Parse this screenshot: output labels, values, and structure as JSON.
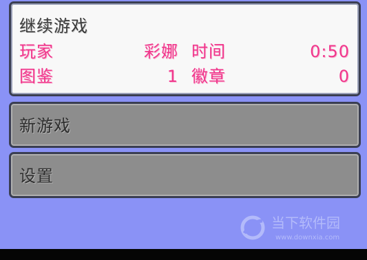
{
  "menu": {
    "continue_title": "继续游戏",
    "player_label": "玩家",
    "player_name": "彩娜",
    "time_label": "时间",
    "time_value": "0:50",
    "pokedex_label": "图鉴",
    "pokedex_value": "1",
    "badge_label": "徽章",
    "badge_value": "0",
    "new_game": "新游戏",
    "settings": "设置"
  },
  "watermark": {
    "title": "当下软件园",
    "url": "www.downxia.com",
    "icon": "watermark-logo-icon"
  },
  "colors": {
    "background": "#8a92f6",
    "panel_white": "#f8f8f8",
    "panel_gray": "#8d8d8d",
    "accent_pink": "#f0378c"
  }
}
